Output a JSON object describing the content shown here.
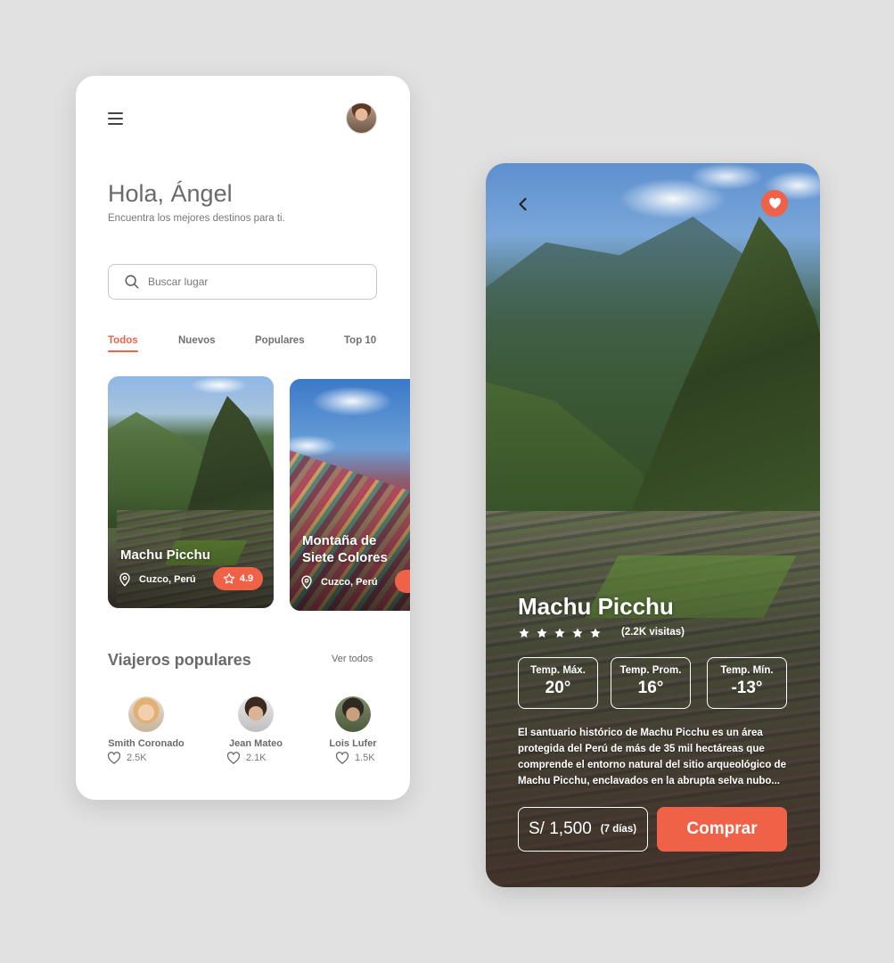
{
  "home": {
    "greeting": "Hola, Ángel",
    "subtitle": "Encuentra los mejores destinos para ti.",
    "search": {
      "placeholder": "Buscar lugar"
    },
    "tabs": [
      {
        "label": "Todos",
        "active": true
      },
      {
        "label": "Nuevos",
        "active": false
      },
      {
        "label": "Populares",
        "active": false
      },
      {
        "label": "Top 10",
        "active": false
      }
    ],
    "destinations": [
      {
        "name": "Machu Picchu",
        "location": "Cuzco, Perú",
        "rating": "4.9"
      },
      {
        "name": "Montaña de Siete Colores",
        "location": "Cuzco, Perú",
        "rating": ""
      }
    ],
    "travelers_title": "Viajeros populares",
    "see_all": "Ver todos",
    "travelers": [
      {
        "name": "Smith Coronado",
        "likes": "2.5K"
      },
      {
        "name": "Jean Mateo",
        "likes": "2.1K"
      },
      {
        "name": "Lois Lufer",
        "likes": "1.5K"
      }
    ]
  },
  "detail": {
    "title": "Machu Picchu",
    "stars": 5,
    "visits": "(2.2K visitas)",
    "temps": [
      {
        "label": "Temp. Máx.",
        "value": "20°"
      },
      {
        "label": "Temp. Prom.",
        "value": "16°"
      },
      {
        "label": "Temp. Mín.",
        "value": "-13°"
      }
    ],
    "description": "El santuario histórico de Machu Picchu es un área protegida del Perú de más de 35 mil hectáreas que comprende el entorno natural del sitio arqueológico de Machu Picchu, enclavados en la abrupta selva nubo...",
    "price": "S/ 1,500",
    "duration": "(7 días)",
    "buy_label": "Comprar"
  },
  "colors": {
    "accent": "#f06248",
    "text": "#6a6a6a",
    "background": "#e1e1e1"
  }
}
